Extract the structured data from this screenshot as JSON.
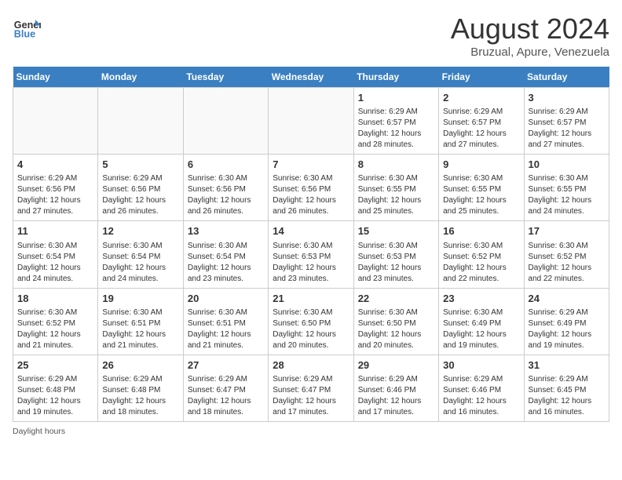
{
  "header": {
    "logo_general": "General",
    "logo_blue": "Blue",
    "month_title": "August 2024",
    "location": "Bruzual, Apure, Venezuela"
  },
  "days_of_week": [
    "Sunday",
    "Monday",
    "Tuesday",
    "Wednesday",
    "Thursday",
    "Friday",
    "Saturday"
  ],
  "footer": {
    "note": "Daylight hours"
  },
  "weeks": [
    [
      {
        "day": "",
        "info": ""
      },
      {
        "day": "",
        "info": ""
      },
      {
        "day": "",
        "info": ""
      },
      {
        "day": "",
        "info": ""
      },
      {
        "day": "1",
        "info": "Sunrise: 6:29 AM\nSunset: 6:57 PM\nDaylight: 12 hours\nand 28 minutes."
      },
      {
        "day": "2",
        "info": "Sunrise: 6:29 AM\nSunset: 6:57 PM\nDaylight: 12 hours\nand 27 minutes."
      },
      {
        "day": "3",
        "info": "Sunrise: 6:29 AM\nSunset: 6:57 PM\nDaylight: 12 hours\nand 27 minutes."
      }
    ],
    [
      {
        "day": "4",
        "info": "Sunrise: 6:29 AM\nSunset: 6:56 PM\nDaylight: 12 hours\nand 27 minutes."
      },
      {
        "day": "5",
        "info": "Sunrise: 6:29 AM\nSunset: 6:56 PM\nDaylight: 12 hours\nand 26 minutes."
      },
      {
        "day": "6",
        "info": "Sunrise: 6:30 AM\nSunset: 6:56 PM\nDaylight: 12 hours\nand 26 minutes."
      },
      {
        "day": "7",
        "info": "Sunrise: 6:30 AM\nSunset: 6:56 PM\nDaylight: 12 hours\nand 26 minutes."
      },
      {
        "day": "8",
        "info": "Sunrise: 6:30 AM\nSunset: 6:55 PM\nDaylight: 12 hours\nand 25 minutes."
      },
      {
        "day": "9",
        "info": "Sunrise: 6:30 AM\nSunset: 6:55 PM\nDaylight: 12 hours\nand 25 minutes."
      },
      {
        "day": "10",
        "info": "Sunrise: 6:30 AM\nSunset: 6:55 PM\nDaylight: 12 hours\nand 24 minutes."
      }
    ],
    [
      {
        "day": "11",
        "info": "Sunrise: 6:30 AM\nSunset: 6:54 PM\nDaylight: 12 hours\nand 24 minutes."
      },
      {
        "day": "12",
        "info": "Sunrise: 6:30 AM\nSunset: 6:54 PM\nDaylight: 12 hours\nand 24 minutes."
      },
      {
        "day": "13",
        "info": "Sunrise: 6:30 AM\nSunset: 6:54 PM\nDaylight: 12 hours\nand 23 minutes."
      },
      {
        "day": "14",
        "info": "Sunrise: 6:30 AM\nSunset: 6:53 PM\nDaylight: 12 hours\nand 23 minutes."
      },
      {
        "day": "15",
        "info": "Sunrise: 6:30 AM\nSunset: 6:53 PM\nDaylight: 12 hours\nand 23 minutes."
      },
      {
        "day": "16",
        "info": "Sunrise: 6:30 AM\nSunset: 6:52 PM\nDaylight: 12 hours\nand 22 minutes."
      },
      {
        "day": "17",
        "info": "Sunrise: 6:30 AM\nSunset: 6:52 PM\nDaylight: 12 hours\nand 22 minutes."
      }
    ],
    [
      {
        "day": "18",
        "info": "Sunrise: 6:30 AM\nSunset: 6:52 PM\nDaylight: 12 hours\nand 21 minutes."
      },
      {
        "day": "19",
        "info": "Sunrise: 6:30 AM\nSunset: 6:51 PM\nDaylight: 12 hours\nand 21 minutes."
      },
      {
        "day": "20",
        "info": "Sunrise: 6:30 AM\nSunset: 6:51 PM\nDaylight: 12 hours\nand 21 minutes."
      },
      {
        "day": "21",
        "info": "Sunrise: 6:30 AM\nSunset: 6:50 PM\nDaylight: 12 hours\nand 20 minutes."
      },
      {
        "day": "22",
        "info": "Sunrise: 6:30 AM\nSunset: 6:50 PM\nDaylight: 12 hours\nand 20 minutes."
      },
      {
        "day": "23",
        "info": "Sunrise: 6:30 AM\nSunset: 6:49 PM\nDaylight: 12 hours\nand 19 minutes."
      },
      {
        "day": "24",
        "info": "Sunrise: 6:29 AM\nSunset: 6:49 PM\nDaylight: 12 hours\nand 19 minutes."
      }
    ],
    [
      {
        "day": "25",
        "info": "Sunrise: 6:29 AM\nSunset: 6:48 PM\nDaylight: 12 hours\nand 19 minutes."
      },
      {
        "day": "26",
        "info": "Sunrise: 6:29 AM\nSunset: 6:48 PM\nDaylight: 12 hours\nand 18 minutes."
      },
      {
        "day": "27",
        "info": "Sunrise: 6:29 AM\nSunset: 6:47 PM\nDaylight: 12 hours\nand 18 minutes."
      },
      {
        "day": "28",
        "info": "Sunrise: 6:29 AM\nSunset: 6:47 PM\nDaylight: 12 hours\nand 17 minutes."
      },
      {
        "day": "29",
        "info": "Sunrise: 6:29 AM\nSunset: 6:46 PM\nDaylight: 12 hours\nand 17 minutes."
      },
      {
        "day": "30",
        "info": "Sunrise: 6:29 AM\nSunset: 6:46 PM\nDaylight: 12 hours\nand 16 minutes."
      },
      {
        "day": "31",
        "info": "Sunrise: 6:29 AM\nSunset: 6:45 PM\nDaylight: 12 hours\nand 16 minutes."
      }
    ]
  ]
}
